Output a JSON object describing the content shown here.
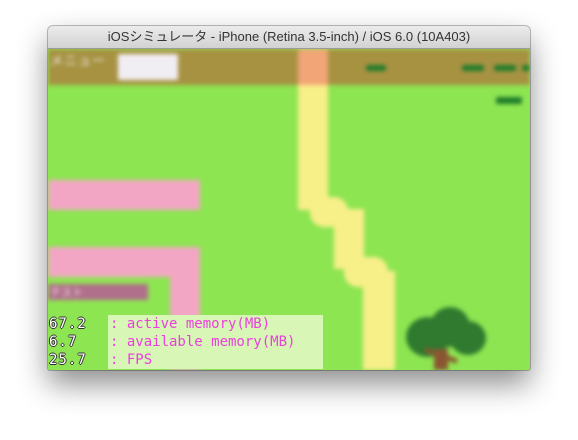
{
  "window": {
    "title": "iOSシミュレータ - iPhone (Retina 3.5-inch) / iOS 6.0 (10A403)"
  },
  "game": {
    "menu_label": "メニュー",
    "bubble_text": "テスト",
    "colors": {
      "grass": "#8ee552",
      "menubar": "#a79242",
      "road": "#f7ef88",
      "pink_path": "#f2a6c3"
    }
  },
  "stats": [
    {
      "value": "67.2",
      "label": ": active memory(MB)"
    },
    {
      "value": "6.7",
      "label": ": available memory(MB)"
    },
    {
      "value": "25.7",
      "label": ": FPS"
    }
  ]
}
